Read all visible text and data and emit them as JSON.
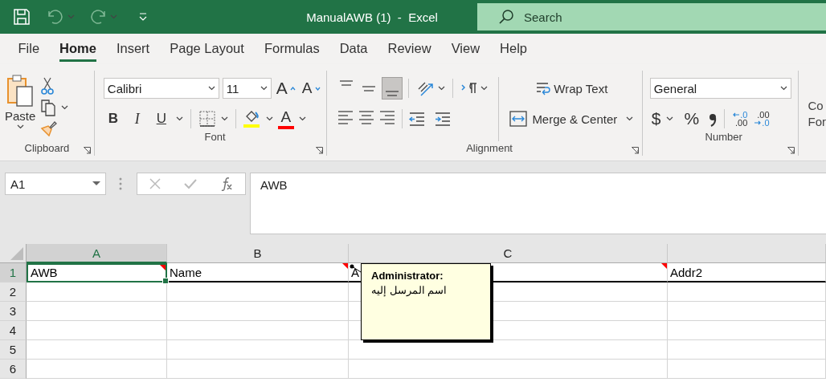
{
  "window": {
    "title": "ManualAWB (1)  -  Excel"
  },
  "search": {
    "placeholder": "Search"
  },
  "tabs": [
    {
      "label": "File",
      "selected": false
    },
    {
      "label": "Home",
      "selected": true
    },
    {
      "label": "Insert",
      "selected": false
    },
    {
      "label": "Page Layout",
      "selected": false
    },
    {
      "label": "Formulas",
      "selected": false
    },
    {
      "label": "Data",
      "selected": false
    },
    {
      "label": "Review",
      "selected": false
    },
    {
      "label": "View",
      "selected": false
    },
    {
      "label": "Help",
      "selected": false
    }
  ],
  "ribbon": {
    "clipboard": {
      "paste": "Paste",
      "label": "Clipboard"
    },
    "font": {
      "family": "Calibri",
      "size": "11",
      "grow": "A",
      "shrink": "A",
      "bold": "B",
      "italic": "I",
      "underline": "U",
      "color_letter": "A",
      "label": "Font"
    },
    "alignment": {
      "vertical": [
        {
          "selected": false
        },
        {
          "selected": false
        },
        {
          "selected": true
        }
      ],
      "wrap": "Wrap Text",
      "merge": "Merge & Center",
      "label": "Alignment"
    },
    "number": {
      "format": "General",
      "currency": "$",
      "percent": "%",
      "increase_decimal": [
        ".0",
        ".00"
      ],
      "decrease_decimal": [
        ".00",
        ".0"
      ],
      "label": "Number"
    },
    "next_group": [
      "Co",
      "For"
    ]
  },
  "formula_bar": {
    "name_box": "A1",
    "value": "AWB"
  },
  "sheet": {
    "columns": [
      {
        "label": "A",
        "selected": true
      },
      {
        "label": "B",
        "selected": false
      },
      {
        "label": "C",
        "selected": false
      }
    ],
    "rows": [
      {
        "number": "1",
        "selected": true,
        "cells": [
          {
            "text": "AWB",
            "comment": true,
            "active": true
          },
          {
            "text": "Name",
            "comment": true,
            "active": false
          },
          {
            "text": "A",
            "comment": true,
            "active": false
          },
          {
            "text": "Addr2",
            "comment": false,
            "active": false
          }
        ]
      },
      {
        "number": "2",
        "selected": false
      },
      {
        "number": "3",
        "selected": false
      },
      {
        "number": "4",
        "selected": false
      },
      {
        "number": "5",
        "selected": false
      },
      {
        "number": "6",
        "selected": false
      }
    ]
  },
  "comment": {
    "author": "Administrator:",
    "text": "اسم المرسل إليه"
  }
}
